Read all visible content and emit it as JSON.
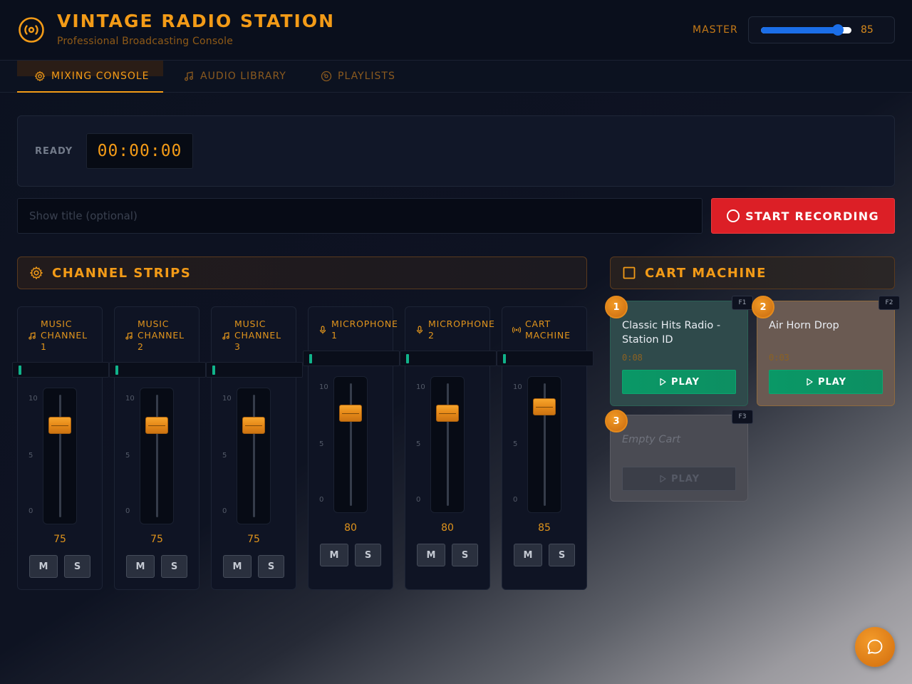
{
  "header": {
    "title": "VINTAGE RADIO STATION",
    "subtitle": "Professional Broadcasting Console",
    "master_label": "MASTER",
    "master_value": "85",
    "master_level": 0.85
  },
  "tabs": [
    {
      "label": "MIXING CONSOLE",
      "icon": "gear-icon",
      "active": true
    },
    {
      "label": "AUDIO LIBRARY",
      "icon": "music-note-icon",
      "active": false
    },
    {
      "label": "PLAYLISTS",
      "icon": "disc-icon",
      "active": false
    }
  ],
  "status": {
    "label": "READY",
    "timer": "00:00:00"
  },
  "recording": {
    "placeholder": "Show title (optional)",
    "button_label": "START RECORDING"
  },
  "channel_strips": {
    "title": "CHANNEL STRIPS",
    "channels": [
      {
        "name_line1": "MUSIC",
        "name_line2": "CHANNEL",
        "name_line3": "1",
        "icon": "music-note-icon",
        "value": "75",
        "level": 75,
        "scale": [
          "10",
          "5",
          "0"
        ],
        "mute": "M",
        "solo": "S"
      },
      {
        "name_line1": "MUSIC",
        "name_line2": "CHANNEL",
        "name_line3": "2",
        "icon": "music-note-icon",
        "value": "75",
        "level": 75,
        "scale": [
          "10",
          "5",
          "0"
        ],
        "mute": "M",
        "solo": "S"
      },
      {
        "name_line1": "MUSIC",
        "name_line2": "CHANNEL",
        "name_line3": "3",
        "icon": "music-note-icon",
        "value": "75",
        "level": 75,
        "scale": [
          "10",
          "5",
          "0"
        ],
        "mute": "M",
        "solo": "S"
      },
      {
        "name_line1": "MICROPHONE",
        "name_line2": "1",
        "name_line3": "",
        "icon": "microphone-icon",
        "value": "80",
        "level": 80,
        "scale": [
          "10",
          "5",
          "0"
        ],
        "mute": "M",
        "solo": "S"
      },
      {
        "name_line1": "MICROPHONE",
        "name_line2": "2",
        "name_line3": "",
        "icon": "microphone-icon",
        "value": "80",
        "level": 80,
        "scale": [
          "10",
          "5",
          "0"
        ],
        "mute": "M",
        "solo": "S"
      },
      {
        "name_line1": "CART",
        "name_line2": "MACHINE",
        "name_line3": "",
        "icon": "broadcast-icon",
        "value": "85",
        "level": 85,
        "scale": [
          "10",
          "5",
          "0"
        ],
        "mute": "M",
        "solo": "S"
      }
    ]
  },
  "cart_machine": {
    "title": "CART MACHINE",
    "carts": [
      {
        "number": "1",
        "hotkey": "F1",
        "title": "Classic Hits Radio - Station ID",
        "duration": "0:08",
        "play_label": "PLAY"
      },
      {
        "number": "2",
        "hotkey": "F2",
        "title": "Air Horn Drop",
        "duration": "0:03",
        "play_label": "PLAY"
      },
      {
        "number": "3",
        "hotkey": "F3",
        "title": "Empty Cart",
        "duration": "",
        "play_label": "PLAY"
      }
    ]
  },
  "colors": {
    "accent": "#f39b17",
    "record": "#dc1f26",
    "play": "#0a9866",
    "meter": "#11b38a"
  }
}
